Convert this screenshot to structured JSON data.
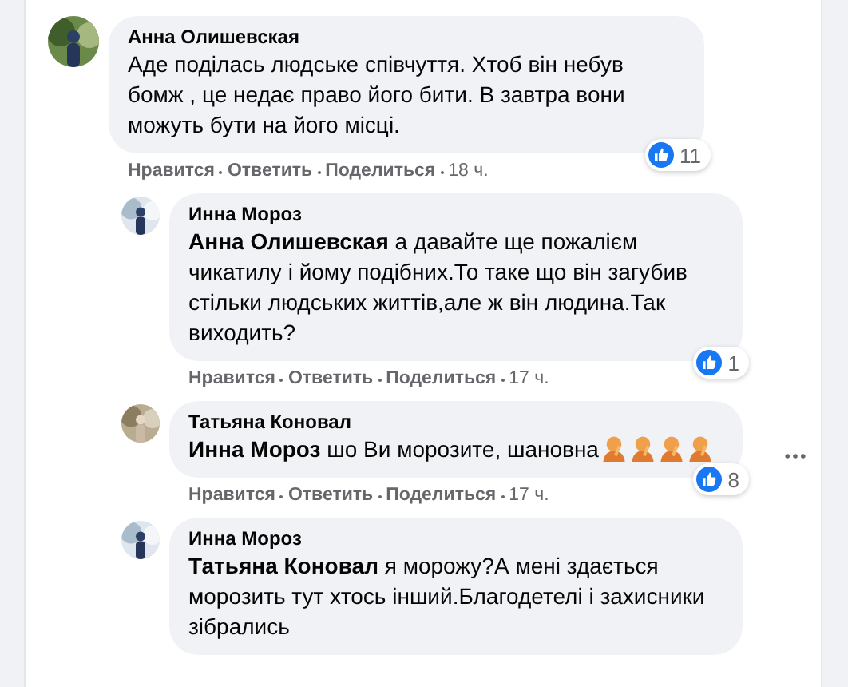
{
  "comments": [
    {
      "author": "Анна Олишевская",
      "reply": false,
      "body": [
        {
          "kind": "text",
          "text": "Аде поділась людське співчуття. Хтоб він небув бомж , це недає право його бити. В завтра вони можуть бути на його місці."
        }
      ],
      "actions": [
        "Нравится",
        "Ответить",
        "Поделиться"
      ],
      "time": "18 ч.",
      "likes": "11",
      "menu": false
    },
    {
      "author": "Инна Мороз",
      "reply": true,
      "body": [
        {
          "kind": "mention",
          "text": "Анна Олишевская"
        },
        {
          "kind": "text",
          "text": " а давайте ще пожалієм чикатилу і йому подібних.То таке що він загубив стільки людських життів,але ж він людина.Так виходить?"
        }
      ],
      "actions": [
        "Нравится",
        "Ответить",
        "Поделиться"
      ],
      "time": "17 ч.",
      "likes": "1",
      "menu": false
    },
    {
      "author": "Татьяна Коновал",
      "reply": true,
      "body": [
        {
          "kind": "mention",
          "text": "Инна Мороз"
        },
        {
          "kind": "text",
          "text": " шо Ви морозите, шановна"
        },
        {
          "kind": "emoji"
        },
        {
          "kind": "emoji"
        },
        {
          "kind": "emoji"
        },
        {
          "kind": "emoji"
        }
      ],
      "actions": [
        "Нравится",
        "Ответить",
        "Поделиться"
      ],
      "time": "17 ч.",
      "likes": "8",
      "menu": true
    },
    {
      "author": "Инна Мороз",
      "reply": true,
      "body": [
        {
          "kind": "mention",
          "text": "Татьяна Коновал"
        },
        {
          "kind": "text",
          "text": " я морожу?А мені здається морозить тут хтось інший.Благодетелі і захисники зібрались"
        }
      ],
      "menu": false
    }
  ]
}
